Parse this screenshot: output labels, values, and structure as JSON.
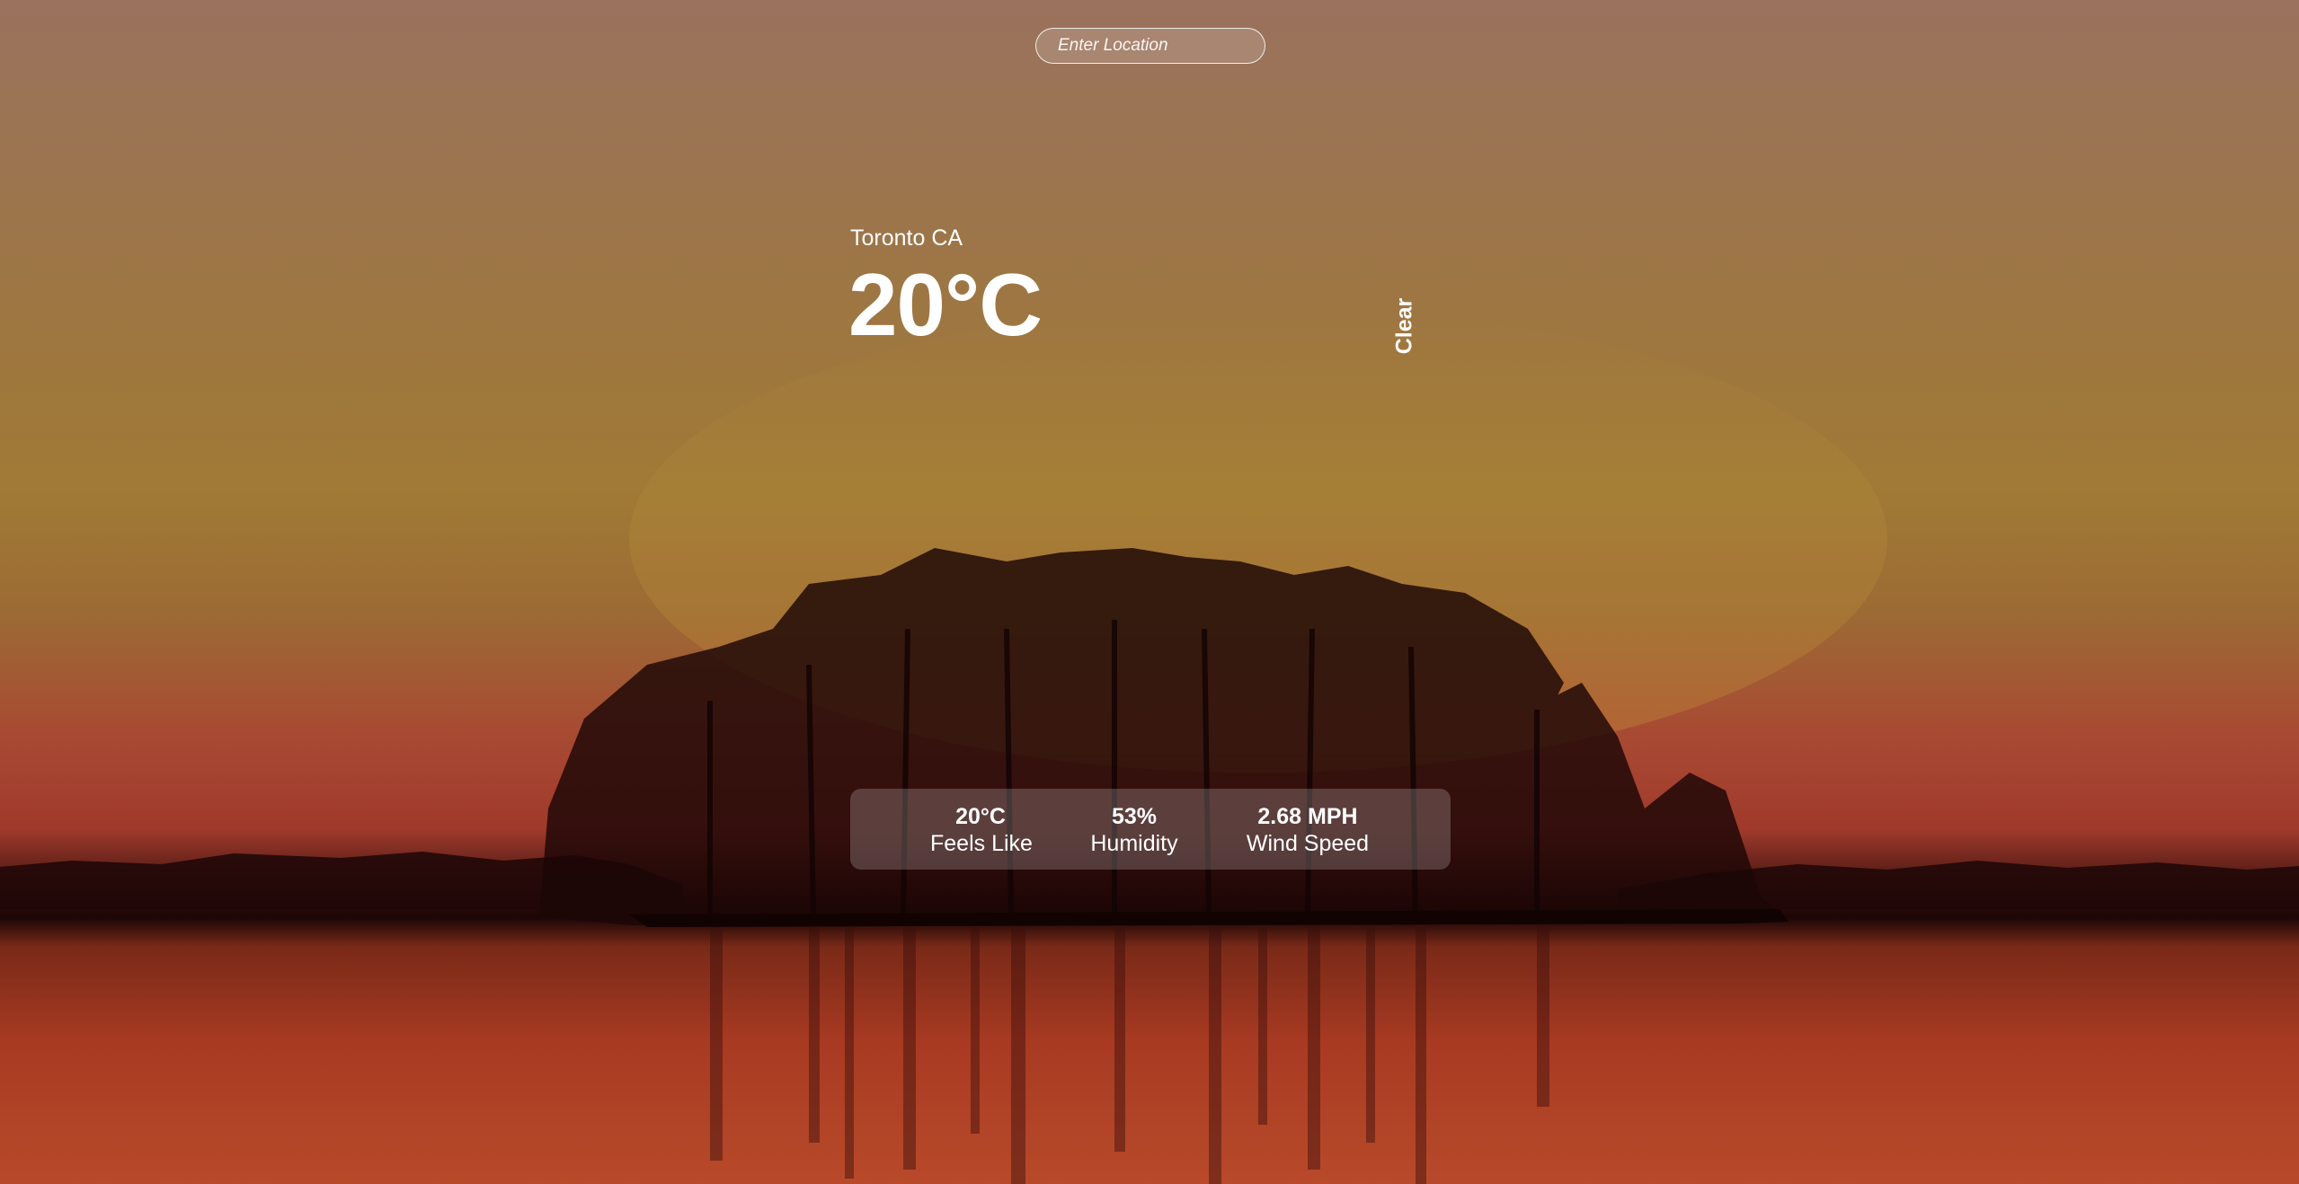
{
  "search": {
    "placeholder": "Enter Location",
    "value": ""
  },
  "weather": {
    "location": "Toronto CA",
    "temperature": "20°C",
    "condition": "Clear"
  },
  "details": [
    {
      "value": "20°C",
      "label": "Feels Like"
    },
    {
      "value": "53%",
      "label": "Humidity"
    },
    {
      "value": "2.68 MPH",
      "label": "Wind Speed"
    }
  ],
  "colors": {
    "sky_top": "#9a725e",
    "sky_mid": "#a07a35",
    "horizon": "#a03a2c",
    "water": "#b84a2a",
    "panel": "rgba(255,255,255,0.2)",
    "text": "#ffffff"
  }
}
